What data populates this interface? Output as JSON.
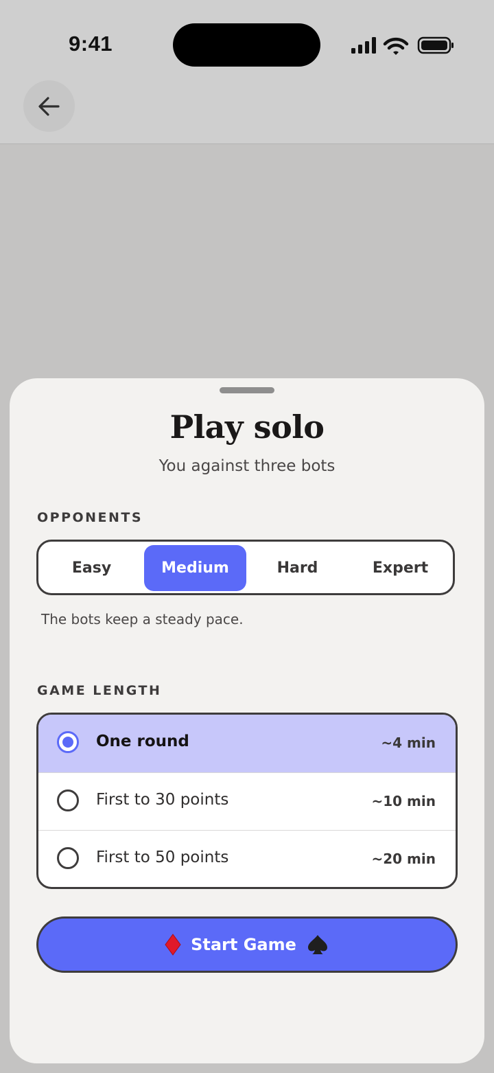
{
  "status_bar": {
    "time": "9:41"
  },
  "sheet": {
    "title": "Play solo",
    "subtitle": "You against three bots",
    "opponents": {
      "label": "OPPONENTS",
      "options": [
        "Easy",
        "Medium",
        "Hard",
        "Expert"
      ],
      "selected": "Medium",
      "description": "The bots keep a steady pace."
    },
    "game_length": {
      "label": "GAME LENGTH",
      "options": [
        {
          "label": "One round",
          "time": "~4 min",
          "selected": true
        },
        {
          "label": "First to 30 points",
          "time": "~10 min",
          "selected": false
        },
        {
          "label": "First to 50 points",
          "time": "~20 min",
          "selected": false
        }
      ]
    },
    "start_button": {
      "label": "Start Game",
      "left_icon": "diamond-suit-icon",
      "right_icon": "spade-suit-icon"
    }
  },
  "colors": {
    "accent": "#5b6af8",
    "selected_row": "#c7c7fa",
    "diamond_red": "#e0192a",
    "sheet_bg": "#f3f2f0",
    "backdrop": "#c4c3c2"
  }
}
